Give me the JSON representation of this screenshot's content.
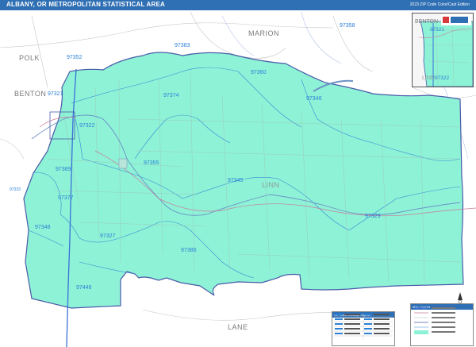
{
  "header": {
    "title": "ALBANY, OR METROPOLITAN STATISTICAL AREA",
    "edition": "2023 ZIP Code Color/Cast Edition"
  },
  "counties": {
    "marion": "MARION",
    "polk": "POLK",
    "benton": "BENTON",
    "linn": "LINN",
    "lane": "LANE"
  },
  "zips": {
    "z97358": "97358",
    "z97383": "97383",
    "z97352": "97352",
    "z97360": "97360",
    "z97374": "97374",
    "z97346": "97346",
    "z97321": "97321",
    "z97322": "97322",
    "z97389": "97389",
    "z97355": "97355",
    "z97345": "97345",
    "z97377": "97377",
    "z97329": "97329",
    "z97348": "97348",
    "z97327": "97327",
    "z97386": "97386",
    "z97446": "97446",
    "z97333": "97333"
  },
  "inset": {
    "benton": "BENTON",
    "linn": "LINN",
    "z97321": "97321",
    "z97322": "97322"
  },
  "legend": {
    "header": "ZIP Code Lookup Legend"
  },
  "key": {
    "header": "Map Legend"
  },
  "colors": {
    "area_fill": "#8ef2d6",
    "county_border": "#4a5aa8",
    "zip_border": "#3a8ad8",
    "highway": "#3b6fd8",
    "title_bar": "#2f6fb3"
  }
}
